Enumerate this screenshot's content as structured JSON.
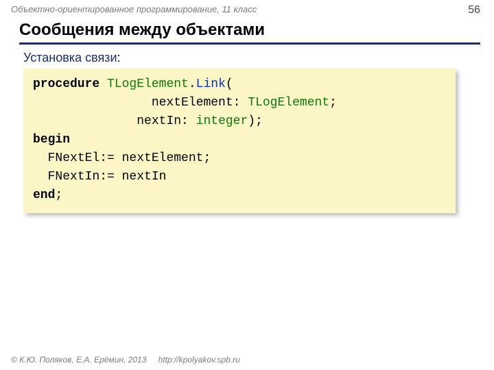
{
  "header": {
    "breadcrumb": "Объектно-ориентированное программирование, 11 класс",
    "page_number": "56"
  },
  "title": "Сообщения между объектами",
  "subtitle": "Установка связи",
  "code": {
    "kw_procedure": "procedure",
    "class_name": "TLogElement",
    "dot": ".",
    "method_name": "Link",
    "open_paren": "(",
    "param1_name": "nextElement",
    "colon1": ":",
    "param1_type": "TLogElement",
    "semicolon1": ";",
    "param2_name": "nextIn",
    "colon2": ":",
    "param2_type": "integer",
    "close_paren": ")",
    "semicolon2": ";",
    "kw_begin": "begin",
    "line1": "FNextEl:= nextElement;",
    "line2": "FNextIn:= nextIn",
    "kw_end": "end",
    "end_semicolon": ";"
  },
  "footer": {
    "copyright": "© К.Ю. Поляков, Е.А. Ерёмин, 2013",
    "link": "http://kpolyakov.spb.ru"
  }
}
